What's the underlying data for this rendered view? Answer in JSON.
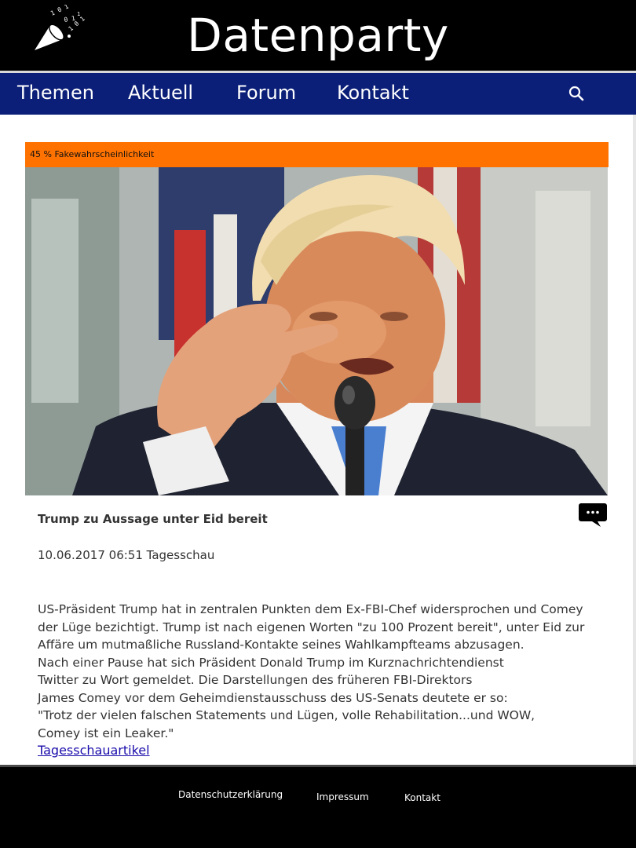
{
  "header": {
    "title": "Datenparty",
    "logo_icon": "party-popper-icon"
  },
  "nav": {
    "items": [
      {
        "label": "Themen"
      },
      {
        "label": "Aktuell"
      },
      {
        "label": "Forum"
      },
      {
        "label": "Kontakt"
      }
    ],
    "search_icon": "search-icon"
  },
  "article": {
    "fake_badge": "45 % Fakewahrscheinlichkeit",
    "fake_probability_percent": 45,
    "badge_color": "#ff7200",
    "title": "Trump zu Aussage unter Eid bereit",
    "meta": "10.06.2017 06:51 Tagesschau",
    "comment_icon": "speech-bubble-icon",
    "body_lines": [
      "US-Präsident Trump hat in zentralen Punkten dem Ex-FBI-Chef widersprochen und Comey",
      "der Lüge bezichtigt. Trump ist nach eigenen Worten \"zu 100 Prozent bereit\", unter Eid zur",
      "Affäre um mutmaßliche Russland-Kontakte seines Wahlkampfteams abzusagen.",
      "Nach einer Pause hat sich Präsident Donald Trump im Kurznachrichtendienst",
      "Twitter zu Wort gemeldet. Die Darstellungen des früheren FBI-Direktors",
      "James Comey vor dem Geheimdienstausschuss des US-Senats deutete er so:",
      "\"Trotz der vielen falschen Statements und Lügen, volle Rehabilitation...und WOW,",
      "Comey ist ein Leaker.\""
    ],
    "link_label": "Tagesschauartikel"
  },
  "footer": {
    "links": [
      {
        "label": "Datenschutzerklärung"
      },
      {
        "label": "Impressum"
      },
      {
        "label": "Kontakt"
      }
    ]
  },
  "colors": {
    "nav_background": "#0b1f78",
    "header_background": "#000000",
    "link": "#1a0dab"
  }
}
